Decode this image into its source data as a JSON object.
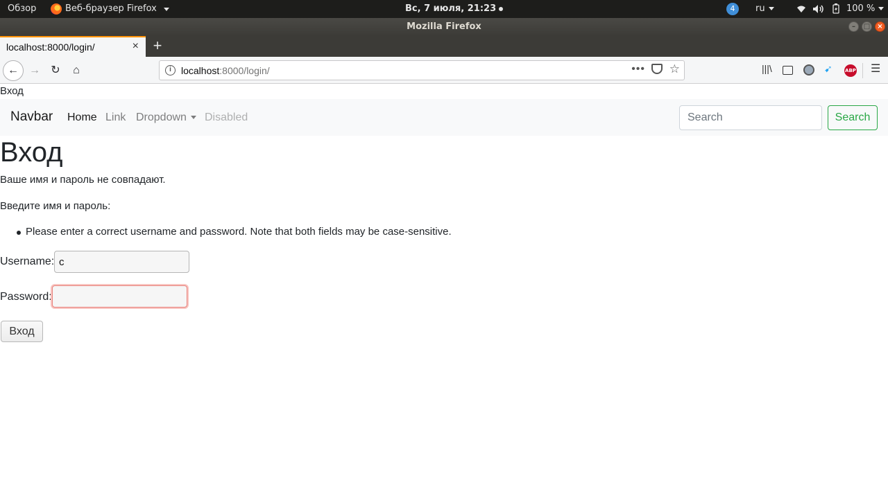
{
  "system": {
    "overview": "Обзор",
    "app_menu": "Веб-браузер Firefox",
    "clock": "Вс, 7 июля, 21:23",
    "notification_count": "4",
    "language": "ru",
    "battery": "100 %"
  },
  "window": {
    "title": "Mozilla Firefox"
  },
  "tab": {
    "title": "localhost:8000/login/",
    "close": "×",
    "new_tab": "+"
  },
  "toolbar": {
    "url_host": "localhost",
    "url_path": ":8000/login/",
    "back": "←",
    "forward": "→",
    "reload": "↻",
    "home": "⌂",
    "more": "•••",
    "bookmark": "☆",
    "library": "|||\\",
    "extension_bird": "➹",
    "abp": "ABP",
    "menu": "☰"
  },
  "page": {
    "top_text": "Вход",
    "navbar": {
      "brand": "Navbar",
      "links": {
        "home": "Home",
        "link": "Link",
        "dropdown": "Dropdown",
        "disabled": "Disabled"
      },
      "search_placeholder": "Search",
      "search_button": "Search"
    },
    "heading": "Вход",
    "message_mismatch": "Ваше имя и пароль не совпадают.",
    "message_prompt": "Введите имя и пароль:",
    "errors": [
      "Please enter a correct username and password. Note that both fields may be case-sensitive."
    ],
    "form": {
      "username_label": "Username:",
      "username_value": "c",
      "password_label": "Password:",
      "password_value": "",
      "submit": "Вход"
    }
  }
}
